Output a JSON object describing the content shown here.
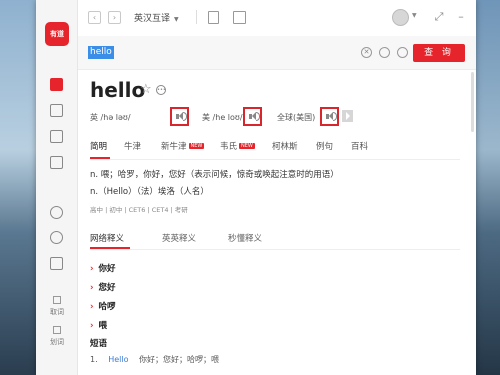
{
  "app": {
    "logo_text": "有道",
    "mode": "英汉互译"
  },
  "sidebar": {
    "items": [
      {
        "label": "取词"
      },
      {
        "label": "划词"
      }
    ]
  },
  "search": {
    "query": "hello",
    "button_label": "查 询"
  },
  "entry": {
    "word": "hello",
    "pron": [
      {
        "region": "英",
        "phonetic": "/hə ləʊ/"
      },
      {
        "region": "美",
        "phonetic": "/he loʊ/"
      },
      {
        "region": "全球(美国)",
        "phonetic": ""
      }
    ]
  },
  "tabs": [
    {
      "label": "简明",
      "active": true
    },
    {
      "label": "牛津"
    },
    {
      "label": "新牛津",
      "badge": "NEW"
    },
    {
      "label": "韦氏",
      "badge": "NEW"
    },
    {
      "label": "柯林斯"
    },
    {
      "label": "例句"
    },
    {
      "label": "百科"
    }
  ],
  "definitions": [
    "n. 喂；哈罗，你好，您好（表示问候，惊奇或唤起注意时的用语）",
    "n.（Hello）（法）埃洛（人名）"
  ],
  "levels": "高中 | 初中 | CET6 | CET4 | 考研",
  "subtabs": [
    {
      "label": "网络释义",
      "active": true
    },
    {
      "label": "英英释义"
    },
    {
      "label": "秒懂释义"
    }
  ],
  "senses": [
    "你好",
    "您好",
    "哈啰",
    "喂"
  ],
  "phrases_title": "短语",
  "phrases": [
    {
      "num": "1.",
      "en": "Hello",
      "zh": "你好；您好；哈啰；喂"
    }
  ]
}
